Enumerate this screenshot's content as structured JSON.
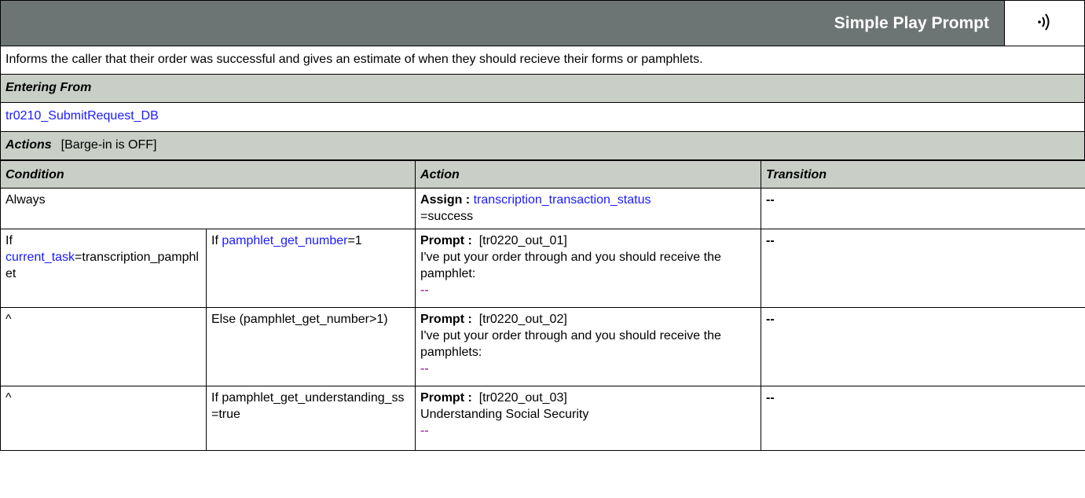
{
  "header": {
    "title": "Simple Play Prompt",
    "icon": "speaker-sound-icon"
  },
  "description": "Informs the caller that their order was successful and gives an estimate of when they should recieve their forms or pamphlets.",
  "entering_from": {
    "label": "Entering From",
    "link": "tr0210_SubmitRequest_DB"
  },
  "actions": {
    "label": "Actions",
    "barge_in": "[Barge-in is OFF]",
    "columns": [
      "Condition",
      "Action",
      "Transition"
    ],
    "rows": [
      {
        "condition": "Always",
        "action_label": "Assign :",
        "action_link": "transcription_transaction_status",
        "action_text": "=success",
        "transition": "--"
      },
      {
        "cond1_prefix": "If",
        "cond1_link": "current_task",
        "cond1_text": "=transcription_pamphlet",
        "cond2_prefix": "If",
        "cond2_link": "pamphlet_get_number",
        "cond2_text": "=1",
        "action_label": "Prompt :",
        "prompt_id": "[tr0220_out_01]",
        "prompt_text": "I've put your order through and you should receive the pamphlet:",
        "prompt_dash": "--",
        "transition": "--"
      },
      {
        "cond1": "^",
        "cond2": "Else (pamphlet_get_number>1)",
        "action_label": "Prompt :",
        "prompt_id": "[tr0220_out_02]",
        "prompt_text": "I've put your order through and you should receive the pamphlets:",
        "prompt_dash": "--",
        "transition": "--"
      },
      {
        "cond1": "^",
        "cond2": "If pamphlet_get_understanding_ss=true",
        "action_label": "Prompt :",
        "prompt_id": "[tr0220_out_03]",
        "prompt_text": "Understanding Social Security",
        "prompt_dash": "--",
        "transition": "--"
      }
    ]
  },
  "colors": {
    "header_bg": "#6c7573",
    "section_bg": "#c9cec6",
    "link": "#1a1aff",
    "dash": "#800080"
  }
}
